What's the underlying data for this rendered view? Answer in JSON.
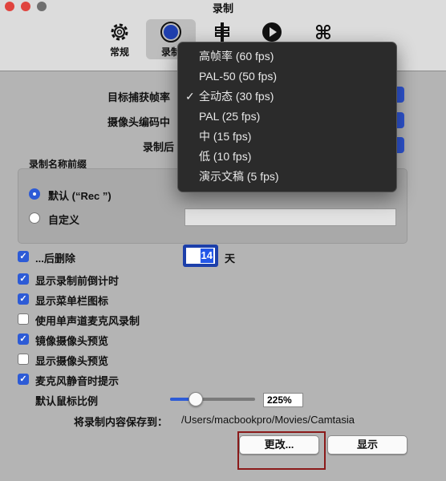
{
  "window": {
    "title": "录制"
  },
  "toolbar": {
    "tabs": [
      {
        "label": "常规",
        "icon": "gear-icon"
      },
      {
        "label": "录制",
        "icon": "record-circle-icon"
      },
      {
        "label": "",
        "icon": "signpost-icon"
      },
      {
        "label": "",
        "icon": "play-icon"
      },
      {
        "label": "",
        "icon": "command-key-icon"
      }
    ]
  },
  "form": {
    "fps_label": "目标捕获帧率",
    "codec_label": "摄像头编码中",
    "after_label": "录制后",
    "name_prefix_group": "录制名称前缀",
    "default_option": "默认 (“Rec ”)",
    "custom_option": "自定义",
    "custom_value": "",
    "delete_after_label": "...后删除",
    "delete_after_days": "14",
    "days_unit": "天",
    "checkboxes": [
      {
        "label": "显示录制前倒计时",
        "checked": true
      },
      {
        "label": "显示菜单栏图标",
        "checked": true
      },
      {
        "label": "使用单声道麦克风录制",
        "checked": false
      },
      {
        "label": "镜像摄像头预览",
        "checked": true
      },
      {
        "label": "显示摄像头预览",
        "checked": false
      },
      {
        "label": "麦克风静音时提示",
        "checked": true
      }
    ],
    "cursor_scale_label": "默认鼠标比例",
    "cursor_scale_value": "225%",
    "cursor_scale_fraction": 0.3,
    "save_to_label": "将录制内容保存到：",
    "save_path": "/Users/macbookpro/Movies/Camtasia",
    "change_button": "更改...",
    "show_button": "显示"
  },
  "fps_menu": {
    "items": [
      {
        "label": "高帧率 (60 fps)",
        "checked": false
      },
      {
        "label": "PAL-50 (50 fps)",
        "checked": false
      },
      {
        "label": "全动态 (30 fps)",
        "checked": true
      },
      {
        "label": "PAL (25 fps)",
        "checked": false
      },
      {
        "label": "中 (15 fps)",
        "checked": false
      },
      {
        "label": "低 (10 fps)",
        "checked": false
      },
      {
        "label": "演示文稿 (5 fps)",
        "checked": false
      }
    ]
  },
  "colors": {
    "accent": "#2d5bd6",
    "highlight_border": "#8b1a1a"
  }
}
